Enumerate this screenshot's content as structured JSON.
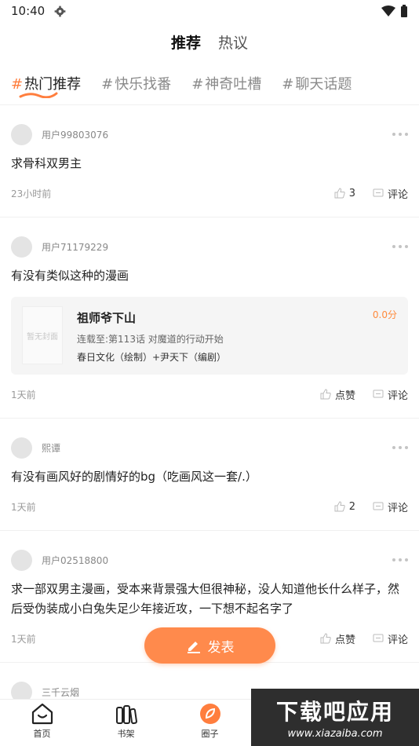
{
  "status": {
    "time": "10:40"
  },
  "top_tabs": [
    {
      "label": "推荐",
      "active": true
    },
    {
      "label": "热议",
      "active": false
    }
  ],
  "topics": [
    {
      "hash": "#",
      "label": "热门推荐",
      "active": true
    },
    {
      "hash": "#",
      "label": "快乐找番",
      "active": false
    },
    {
      "hash": "#",
      "label": "神奇吐槽",
      "active": false
    },
    {
      "hash": "#",
      "label": "聊天话题",
      "active": false
    }
  ],
  "posts": [
    {
      "user": "用户99803076",
      "content": "求骨科双男主",
      "time": "23小时前",
      "like": "3",
      "comment": "评论"
    },
    {
      "user": "用户71179229",
      "content": "有没有类似这种的漫画",
      "time": "1天前",
      "like": "点赞",
      "comment": "评论",
      "book": {
        "title": "祖师爷下山",
        "update": "连载至:第113话 对魔道的行动开始",
        "authors": "春日文化（绘制）+尹天下（编剧）",
        "score": "0.0分",
        "cover_text": "暂无封面"
      }
    },
    {
      "user": "熙谭",
      "content": "有没有画风好的剧情好的bg（吃画风这一套/.）",
      "time": "1天前",
      "like": "2",
      "comment": "评论"
    },
    {
      "user": "用户02518800",
      "content": "求一部双男主漫画，受本来背景强大但很神秘，没人知道他长什么样子，然后受伪装成小白兔失足少年接近攻，一下想不起名字了",
      "time": "1天前",
      "like": "点赞",
      "comment": "评论"
    },
    {
      "user": "三千云烟"
    }
  ],
  "fab": {
    "label": "发表"
  },
  "nav": [
    {
      "label": "首页",
      "icon": "home-icon"
    },
    {
      "label": "书架",
      "icon": "bookshelf-icon"
    },
    {
      "label": "圈子",
      "icon": "circle-icon"
    }
  ],
  "watermark": {
    "title": "下载吧应用",
    "url": "www.xiazaiba.com"
  },
  "colors": {
    "accent": "#ff7e3e",
    "fab": "#ff8a4c"
  }
}
